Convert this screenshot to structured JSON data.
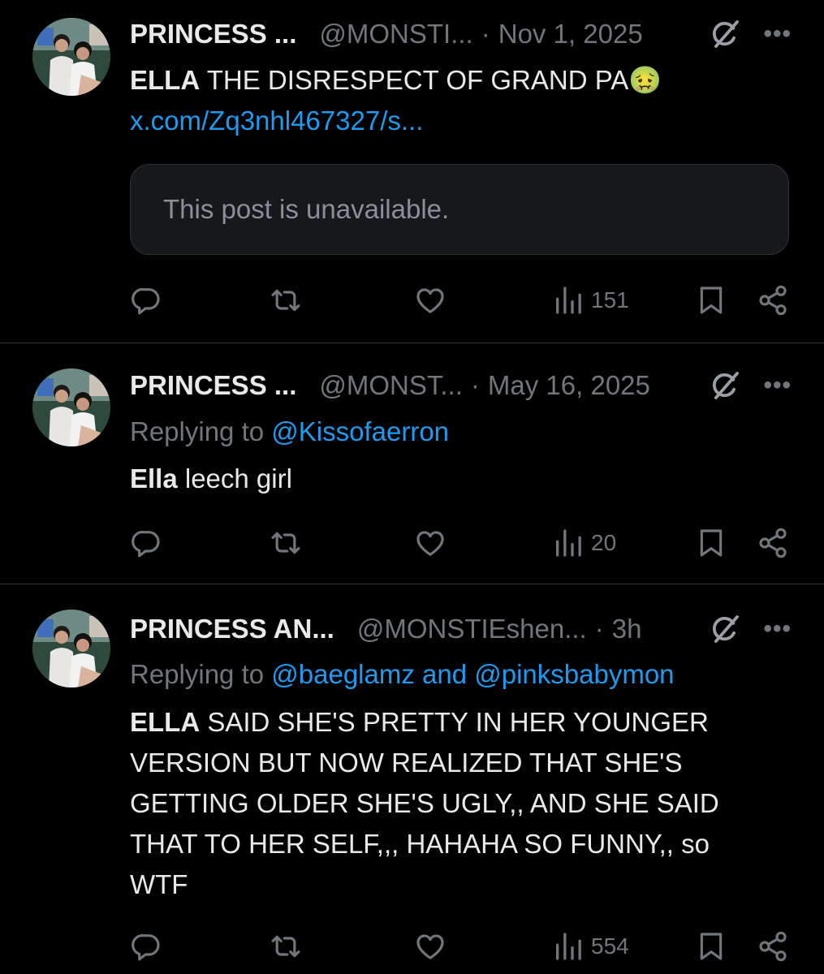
{
  "colors": {
    "background": "#000000",
    "text": "#e7e9ea",
    "muted": "#71767b",
    "link": "#1d9bf0",
    "divider": "#2f3336"
  },
  "icons": {
    "reply": "reply-icon",
    "repost": "repost-icon",
    "like": "like-icon",
    "views": "views-icon",
    "bookmark": "bookmark-icon",
    "share": "share-icon",
    "grok": "grok-icon",
    "more": "more-icon"
  },
  "posts": [
    {
      "name": "PRINCESS ...",
      "handle": "@MONSTI...",
      "separator": "·",
      "date": "Nov 1, 2025",
      "more": "•••",
      "text_bold": "ELLA",
      "text": " THE DISRESPECT OF GRAND PA",
      "emoji": "🤢",
      "link": "x.com/Zq3nhl467327/s...",
      "quote_unavailable": "This post is unavailable.",
      "views": "151"
    },
    {
      "name": "PRINCESS ...",
      "handle": "@MONST...",
      "separator": "·",
      "date": "May 16, 2025",
      "more": "•••",
      "replying_prefix": "Replying to ",
      "replying_to": "@Kissofaerron",
      "text_bold": "Ella",
      "text": " leech girl",
      "views": "20"
    },
    {
      "name": "PRINCESS AN...",
      "handle": "@MONSTIEshen...",
      "separator": "·",
      "date": "3h",
      "more": "•••",
      "replying_prefix": "Replying to ",
      "replying_to": "@baeglamz and @pinksbabymon",
      "text_bold": "ELLA",
      "text": " SAID SHE'S PRETTY IN HER YOUNGER VERSION BUT NOW REALIZED THAT SHE'S GETTING OLDER SHE'S UGLY,, AND SHE SAID THAT TO HER SELF,,, HAHAHA SO FUNNY,, so WTF",
      "views": "554"
    }
  ]
}
